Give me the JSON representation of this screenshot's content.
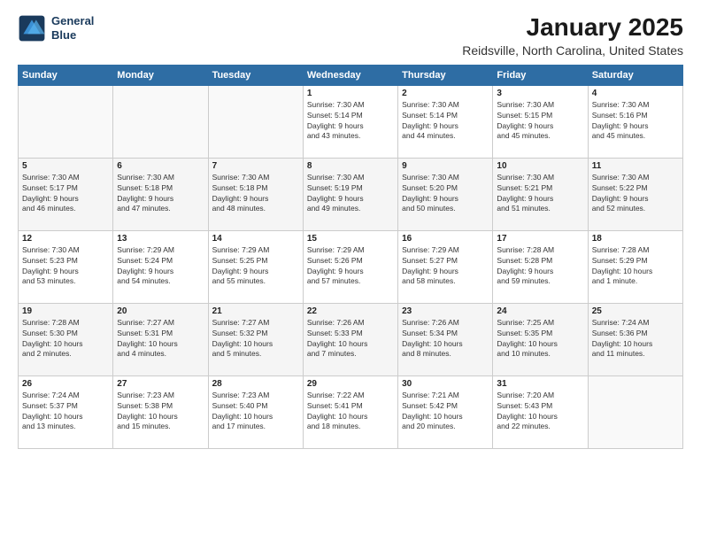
{
  "logo": {
    "line1": "General",
    "line2": "Blue"
  },
  "title": "January 2025",
  "subtitle": "Reidsville, North Carolina, United States",
  "days_of_week": [
    "Sunday",
    "Monday",
    "Tuesday",
    "Wednesday",
    "Thursday",
    "Friday",
    "Saturday"
  ],
  "weeks": [
    [
      {
        "day": "",
        "info": ""
      },
      {
        "day": "",
        "info": ""
      },
      {
        "day": "",
        "info": ""
      },
      {
        "day": "1",
        "info": "Sunrise: 7:30 AM\nSunset: 5:14 PM\nDaylight: 9 hours\nand 43 minutes."
      },
      {
        "day": "2",
        "info": "Sunrise: 7:30 AM\nSunset: 5:14 PM\nDaylight: 9 hours\nand 44 minutes."
      },
      {
        "day": "3",
        "info": "Sunrise: 7:30 AM\nSunset: 5:15 PM\nDaylight: 9 hours\nand 45 minutes."
      },
      {
        "day": "4",
        "info": "Sunrise: 7:30 AM\nSunset: 5:16 PM\nDaylight: 9 hours\nand 45 minutes."
      }
    ],
    [
      {
        "day": "5",
        "info": "Sunrise: 7:30 AM\nSunset: 5:17 PM\nDaylight: 9 hours\nand 46 minutes."
      },
      {
        "day": "6",
        "info": "Sunrise: 7:30 AM\nSunset: 5:18 PM\nDaylight: 9 hours\nand 47 minutes."
      },
      {
        "day": "7",
        "info": "Sunrise: 7:30 AM\nSunset: 5:18 PM\nDaylight: 9 hours\nand 48 minutes."
      },
      {
        "day": "8",
        "info": "Sunrise: 7:30 AM\nSunset: 5:19 PM\nDaylight: 9 hours\nand 49 minutes."
      },
      {
        "day": "9",
        "info": "Sunrise: 7:30 AM\nSunset: 5:20 PM\nDaylight: 9 hours\nand 50 minutes."
      },
      {
        "day": "10",
        "info": "Sunrise: 7:30 AM\nSunset: 5:21 PM\nDaylight: 9 hours\nand 51 minutes."
      },
      {
        "day": "11",
        "info": "Sunrise: 7:30 AM\nSunset: 5:22 PM\nDaylight: 9 hours\nand 52 minutes."
      }
    ],
    [
      {
        "day": "12",
        "info": "Sunrise: 7:30 AM\nSunset: 5:23 PM\nDaylight: 9 hours\nand 53 minutes."
      },
      {
        "day": "13",
        "info": "Sunrise: 7:29 AM\nSunset: 5:24 PM\nDaylight: 9 hours\nand 54 minutes."
      },
      {
        "day": "14",
        "info": "Sunrise: 7:29 AM\nSunset: 5:25 PM\nDaylight: 9 hours\nand 55 minutes."
      },
      {
        "day": "15",
        "info": "Sunrise: 7:29 AM\nSunset: 5:26 PM\nDaylight: 9 hours\nand 57 minutes."
      },
      {
        "day": "16",
        "info": "Sunrise: 7:29 AM\nSunset: 5:27 PM\nDaylight: 9 hours\nand 58 minutes."
      },
      {
        "day": "17",
        "info": "Sunrise: 7:28 AM\nSunset: 5:28 PM\nDaylight: 9 hours\nand 59 minutes."
      },
      {
        "day": "18",
        "info": "Sunrise: 7:28 AM\nSunset: 5:29 PM\nDaylight: 10 hours\nand 1 minute."
      }
    ],
    [
      {
        "day": "19",
        "info": "Sunrise: 7:28 AM\nSunset: 5:30 PM\nDaylight: 10 hours\nand 2 minutes."
      },
      {
        "day": "20",
        "info": "Sunrise: 7:27 AM\nSunset: 5:31 PM\nDaylight: 10 hours\nand 4 minutes."
      },
      {
        "day": "21",
        "info": "Sunrise: 7:27 AM\nSunset: 5:32 PM\nDaylight: 10 hours\nand 5 minutes."
      },
      {
        "day": "22",
        "info": "Sunrise: 7:26 AM\nSunset: 5:33 PM\nDaylight: 10 hours\nand 7 minutes."
      },
      {
        "day": "23",
        "info": "Sunrise: 7:26 AM\nSunset: 5:34 PM\nDaylight: 10 hours\nand 8 minutes."
      },
      {
        "day": "24",
        "info": "Sunrise: 7:25 AM\nSunset: 5:35 PM\nDaylight: 10 hours\nand 10 minutes."
      },
      {
        "day": "25",
        "info": "Sunrise: 7:24 AM\nSunset: 5:36 PM\nDaylight: 10 hours\nand 11 minutes."
      }
    ],
    [
      {
        "day": "26",
        "info": "Sunrise: 7:24 AM\nSunset: 5:37 PM\nDaylight: 10 hours\nand 13 minutes."
      },
      {
        "day": "27",
        "info": "Sunrise: 7:23 AM\nSunset: 5:38 PM\nDaylight: 10 hours\nand 15 minutes."
      },
      {
        "day": "28",
        "info": "Sunrise: 7:23 AM\nSunset: 5:40 PM\nDaylight: 10 hours\nand 17 minutes."
      },
      {
        "day": "29",
        "info": "Sunrise: 7:22 AM\nSunset: 5:41 PM\nDaylight: 10 hours\nand 18 minutes."
      },
      {
        "day": "30",
        "info": "Sunrise: 7:21 AM\nSunset: 5:42 PM\nDaylight: 10 hours\nand 20 minutes."
      },
      {
        "day": "31",
        "info": "Sunrise: 7:20 AM\nSunset: 5:43 PM\nDaylight: 10 hours\nand 22 minutes."
      },
      {
        "day": "",
        "info": ""
      }
    ]
  ]
}
